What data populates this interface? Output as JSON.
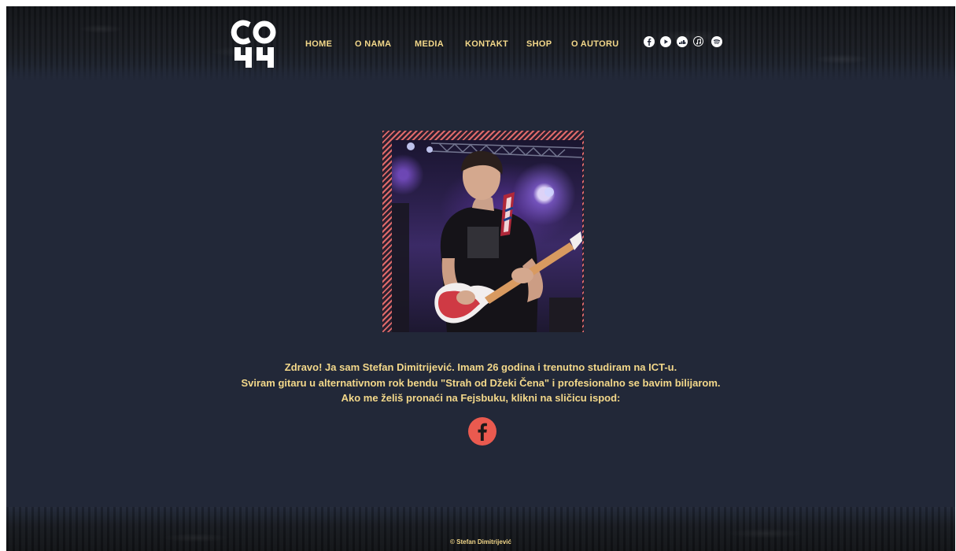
{
  "nav": {
    "items": [
      {
        "label": "HOME"
      },
      {
        "label": "O NAMA"
      },
      {
        "label": "MEDIA"
      },
      {
        "label": "KONTAKT"
      },
      {
        "label": "SHOP"
      },
      {
        "label": "O AUTORU"
      }
    ]
  },
  "socials": [
    "facebook-icon",
    "youtube-icon",
    "deezer-icon",
    "itunes-icon",
    "spotify-icon"
  ],
  "intro": {
    "line1": "Zdravo! Ja sam Stefan Dimitrijević. Imam 26 godina i trenutno studiram na ICT-u.",
    "line2": "Sviram gitaru u alternativnom rok bendu \"Strah od Džeki Čena\" i profesionalno se bavim bilijarom.",
    "line3": "Ako me želiš pronaći na Fejsbuku, klikni na sličicu ispod:"
  },
  "footer": {
    "copyright": "© Stefan Dimitrijević"
  },
  "colors": {
    "background": "#222838",
    "accent_text": "#f3d88a",
    "facebook_button": "#ea5a4f"
  }
}
